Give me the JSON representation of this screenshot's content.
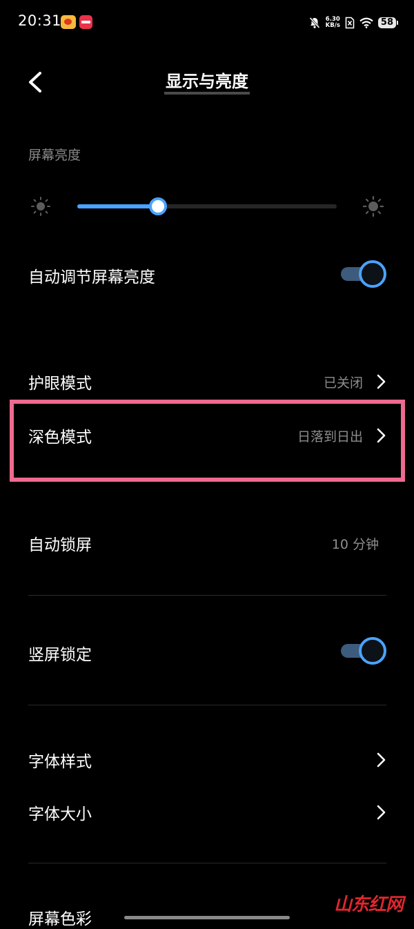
{
  "status_bar": {
    "time": "20:31",
    "net_speed_value": "6.30",
    "net_speed_unit": "KB/s",
    "battery": "58"
  },
  "header": {
    "back_icon": "chevron-left-icon",
    "title": "显示与亮度"
  },
  "brightness": {
    "section_label": "屏幕亮度",
    "level": 0.31,
    "accent_color": "#4aa3ff"
  },
  "settings": {
    "auto_brightness": {
      "label": "自动调节屏幕亮度",
      "enabled": true
    },
    "eye_protection": {
      "label": "护眼模式",
      "value": "已关闭"
    },
    "dark_mode": {
      "label": "深色模式",
      "value": "日落到日出",
      "highlighted": true
    },
    "auto_lock": {
      "label": "自动锁屏",
      "value": "10 分钟"
    },
    "portrait_lock": {
      "label": "竖屏锁定",
      "enabled": true
    },
    "font_style": {
      "label": "字体样式"
    },
    "font_size": {
      "label": "字体大小"
    },
    "screen_color": {
      "label": "屏幕色彩"
    }
  },
  "highlight_color": "#ef6a8f",
  "watermark": "山东红网"
}
